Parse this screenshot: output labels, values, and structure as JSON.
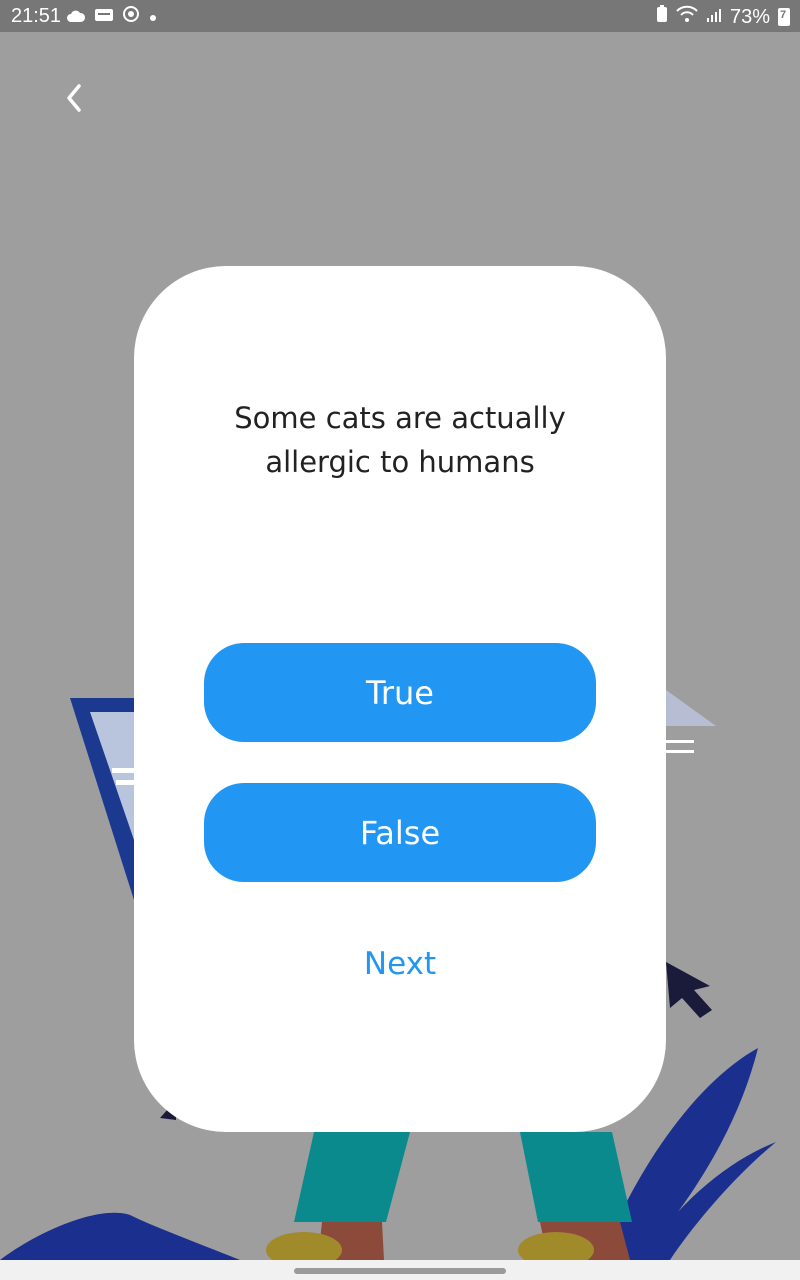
{
  "status_bar": {
    "time": "21:51",
    "battery_percent": "73%",
    "battery_badge": "7",
    "icons": [
      "cloud-icon",
      "webtoon-icon",
      "whatsapp-icon",
      "dot-icon",
      "battery-saver-icon",
      "wifi-icon",
      "signal-icon",
      "battery-icon"
    ]
  },
  "quiz": {
    "question": "Some cats are actually allergic to humans",
    "true_label": "True",
    "false_label": "False",
    "next_label": "Next"
  },
  "colors": {
    "accent": "#2196f3",
    "overlay": "#9e9e9e",
    "card": "#ffffff"
  }
}
